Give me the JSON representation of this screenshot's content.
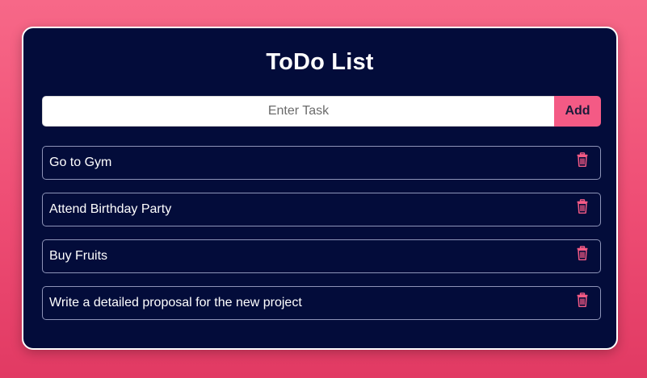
{
  "app": {
    "title": "ToDo List"
  },
  "input": {
    "placeholder": "Enter Task",
    "value": ""
  },
  "add_button": {
    "label": "Add"
  },
  "tasks": [
    {
      "text": "Go to Gym",
      "icon": "trash-icon"
    },
    {
      "text": "Attend Birthday Party",
      "icon": "trash-icon"
    },
    {
      "text": "Buy Fruits",
      "icon": "trash-icon"
    },
    {
      "text": "Write a detailed proposal for the new project",
      "icon": "trash-icon"
    }
  ],
  "colors": {
    "background_top": "#f76888",
    "background_bottom": "#e13a63",
    "card": "#030c3a",
    "accent": "#f45a85",
    "item_border": "#8e94b8",
    "text": "#ffffff"
  }
}
